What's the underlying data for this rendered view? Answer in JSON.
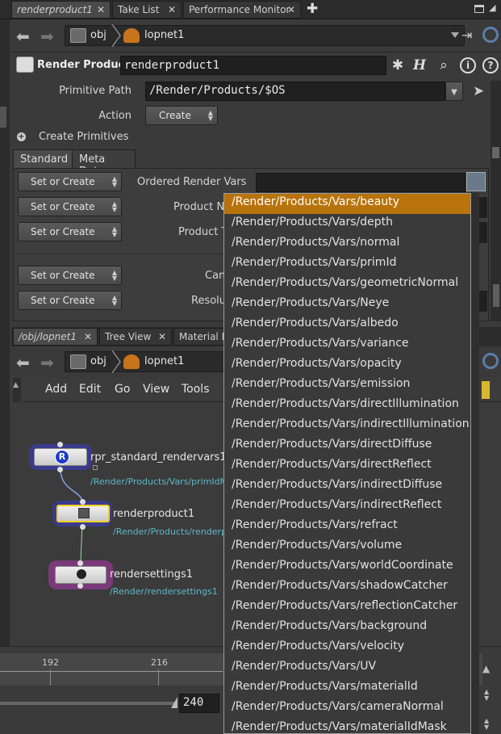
{
  "top_tabs": [
    {
      "label": "renderproduct1",
      "active": true
    },
    {
      "label": "Take List",
      "active": false
    },
    {
      "label": "Performance Monitor",
      "active": false
    }
  ],
  "path": {
    "obj": "obj",
    "net": "lopnet1"
  },
  "params": {
    "node_type": "Render Product",
    "node_name": "renderproduct1",
    "primitive_path_label": "Primitive Path",
    "primitive_path_value": "/Render/Products/$OS",
    "action_label": "Action",
    "action_value": "Create",
    "create_primitives": "Create Primitives",
    "tabs": [
      "Standard",
      "Meta Data"
    ],
    "rows": [
      {
        "mode": "Set or Create",
        "label": "Ordered Render Vars"
      },
      {
        "mode": "Set or Create",
        "label": "Product Na"
      },
      {
        "mode": "Set or Create",
        "label": "Product T"
      },
      {
        "mode": "Set or Create",
        "label": "Cam"
      },
      {
        "mode": "Set or Create",
        "label": "Resolu"
      }
    ]
  },
  "network": {
    "tabs": [
      "/obj/lopnet1",
      "Tree View",
      "Material Pa"
    ],
    "path": {
      "obj": "obj",
      "net": "lopnet1"
    },
    "menu": [
      "Add",
      "Edit",
      "Go",
      "View",
      "Tools"
    ],
    "nodes": [
      {
        "name": "rpr_standard_rendervars1",
        "path": "/Render/Products/Vars/primIdMa",
        "glyph": "R"
      },
      {
        "name": "renderproduct1",
        "path": "/Render/Products/renderpr",
        "glyph": ""
      },
      {
        "name": "rendersettings1",
        "path": "/Render/rendersettings1",
        "glyph": ""
      }
    ]
  },
  "timeline": {
    "ticks": [
      "192",
      "216"
    ],
    "end_frame": "240"
  },
  "dropdown": {
    "selected_index": 0,
    "items": [
      "/Render/Products/Vars/beauty",
      "/Render/Products/Vars/depth",
      "/Render/Products/Vars/normal",
      "/Render/Products/Vars/primId",
      "/Render/Products/Vars/geometricNormal",
      "/Render/Products/Vars/Neye",
      "/Render/Products/Vars/albedo",
      "/Render/Products/Vars/variance",
      "/Render/Products/Vars/opacity",
      "/Render/Products/Vars/emission",
      "/Render/Products/Vars/directIllumination",
      "/Render/Products/Vars/indirectIllumination",
      "/Render/Products/Vars/directDiffuse",
      "/Render/Products/Vars/directReflect",
      "/Render/Products/Vars/indirectDiffuse",
      "/Render/Products/Vars/indirectReflect",
      "/Render/Products/Vars/refract",
      "/Render/Products/Vars/volume",
      "/Render/Products/Vars/worldCoordinate",
      "/Render/Products/Vars/shadowCatcher",
      "/Render/Products/Vars/reflectionCatcher",
      "/Render/Products/Vars/background",
      "/Render/Products/Vars/velocity",
      "/Render/Products/Vars/UV",
      "/Render/Products/Vars/materialId",
      "/Render/Products/Vars/cameraNormal",
      "/Render/Products/Vars/materialIdMask"
    ]
  },
  "colors": {
    "accent": "#b8730d",
    "node_blue": "#3a3a8a",
    "node_purple": "#7a3a7a",
    "path_text": "#5fb8c8"
  }
}
